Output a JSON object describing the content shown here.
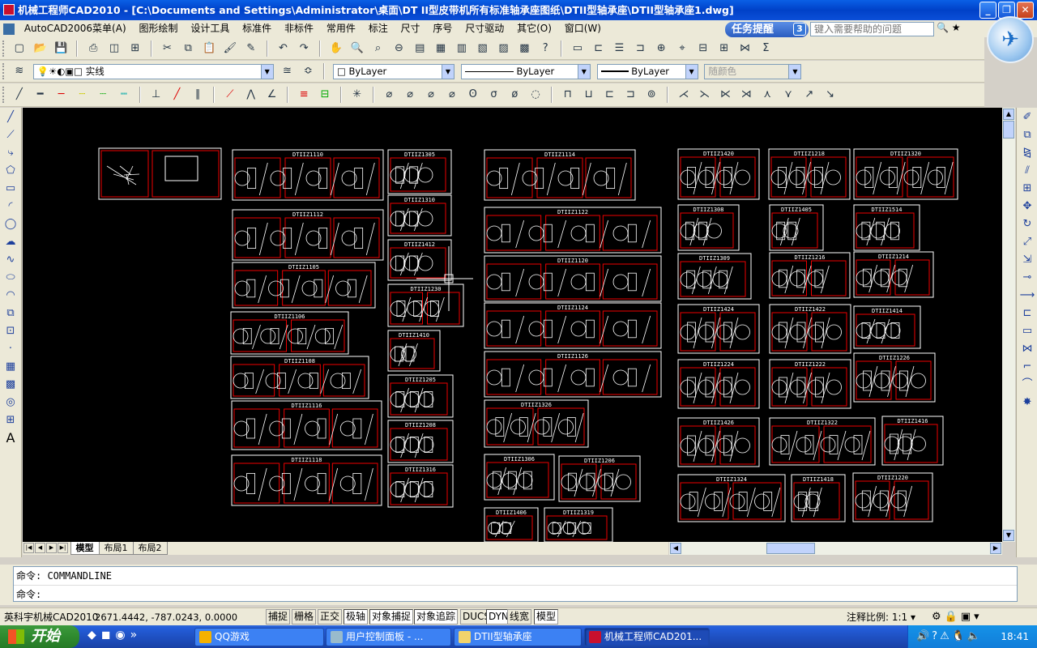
{
  "window": {
    "title": "机械工程师CAD2010 - [C:\\Documents and Settings\\Administrator\\桌面\\DT II型皮带机所有标准轴承座图纸\\DTII型轴承座\\DTII型轴承座1.dwg]",
    "btn_min": "_",
    "btn_max": "❐",
    "btn_close": "✕"
  },
  "menu": {
    "items": [
      "AutoCAD2006菜单(A)",
      "图形绘制",
      "设计工具",
      "标准件",
      "非标件",
      "常用件",
      "标注",
      "尺寸",
      "序号",
      "尺寸驱动",
      "其它(O)",
      "窗口(W)"
    ]
  },
  "taskhint": {
    "label": "任务提醒",
    "count": "3"
  },
  "help": {
    "placeholder": "键入需要帮助的问题"
  },
  "layerbar": {
    "layer_name": "实线",
    "color": "ByLayer",
    "linetype": "ByLayer",
    "lineweight": "ByLayer",
    "plotstyle": "随颜色"
  },
  "tabs": {
    "items": [
      "模型",
      "布局1",
      "布局2"
    ]
  },
  "command": {
    "line1": "命令: COMMANDLINE",
    "line2": "命令:"
  },
  "status": {
    "app_name": "英科宇机械CAD2010",
    "coords": "2671.4442, -787.0243, 0.0000",
    "modes": [
      "捕捉",
      "栅格",
      "正交",
      "极轴",
      "对象捕捉",
      "对象追踪",
      "DUCS",
      "DYN",
      "线宽",
      "模型"
    ],
    "scale_label": "注释比例:",
    "scale_value": "1:1"
  },
  "taskbar": {
    "start": "开始",
    "tasks": [
      "QQ游戏",
      "用户控制面板 - ...",
      "DTII型轴承座",
      "机械工程师CAD201..."
    ],
    "clock": "18:41"
  },
  "drawing": {
    "sheets": [
      "DTIIZ1110",
      "DTIIZ1112",
      "DTIIZ1105",
      "DTIIZ1106",
      "DTIIZ1108",
      "DTIIZ1116",
      "DTIIZ1118",
      "DTIIZ1305",
      "DTIIZ1310",
      "DTIIZ1412",
      "DTIIZ1230",
      "DTIIZ1410",
      "DTIIZ1205",
      "DTIIZ1208",
      "DTIIZ1316",
      "DTIIZ1114",
      "DTIIZ1122",
      "DTIIZ1120",
      "DTIIZ1124",
      "DTIIZ1126",
      "DTIIZ1326",
      "DTIIZ1306",
      "DTIIZ1206",
      "DTIIZ1406",
      "DTIIZ1319",
      "DTIIZ1420",
      "DTIIZ1218",
      "DTIIZ1320",
      "DTIIZ1308",
      "DTIIZ1405",
      "DTIIZ1514",
      "DTIIZ1309",
      "DTIIZ1216",
      "DTIIZ1214",
      "DTIIZ1424",
      "DTIIZ1422",
      "DTIIZ1414",
      "DTIIZ1224",
      "DTIIZ1222",
      "DTIIZ1226",
      "DTIIZ1426",
      "DTIIZ1322",
      "DTIIZ1416",
      "DTIIZ1324",
      "DTIIZ1418",
      "DTIIZ1220"
    ]
  }
}
